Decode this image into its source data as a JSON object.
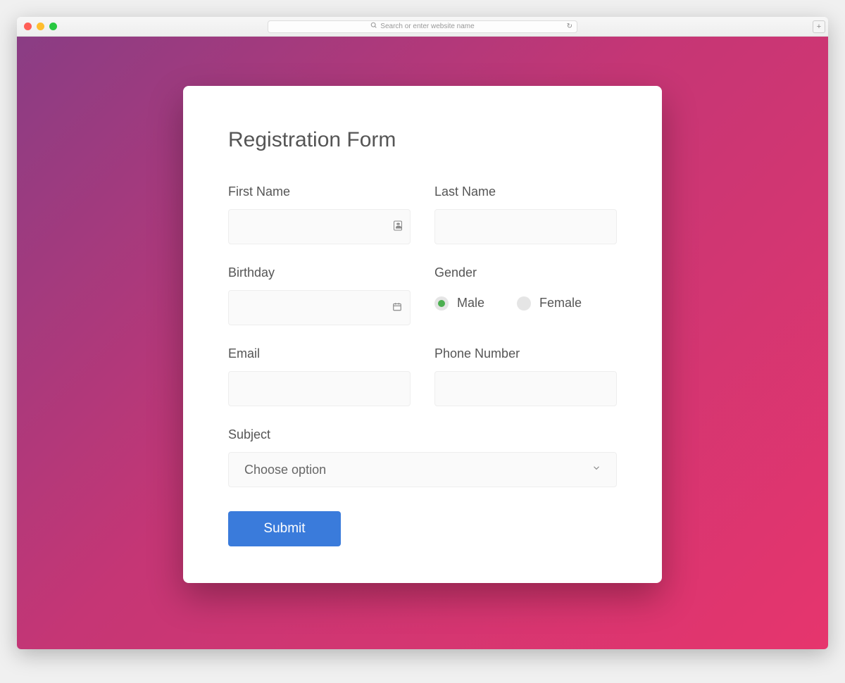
{
  "browser": {
    "address_placeholder": "Search or enter website name"
  },
  "form": {
    "title": "Registration Form",
    "first_name_label": "First Name",
    "last_name_label": "Last Name",
    "birthday_label": "Birthday",
    "gender_label": "Gender",
    "gender_options": {
      "male": "Male",
      "female": "Female"
    },
    "email_label": "Email",
    "phone_label": "Phone Number",
    "subject_label": "Subject",
    "subject_placeholder": "Choose option",
    "submit_label": "Submit"
  }
}
